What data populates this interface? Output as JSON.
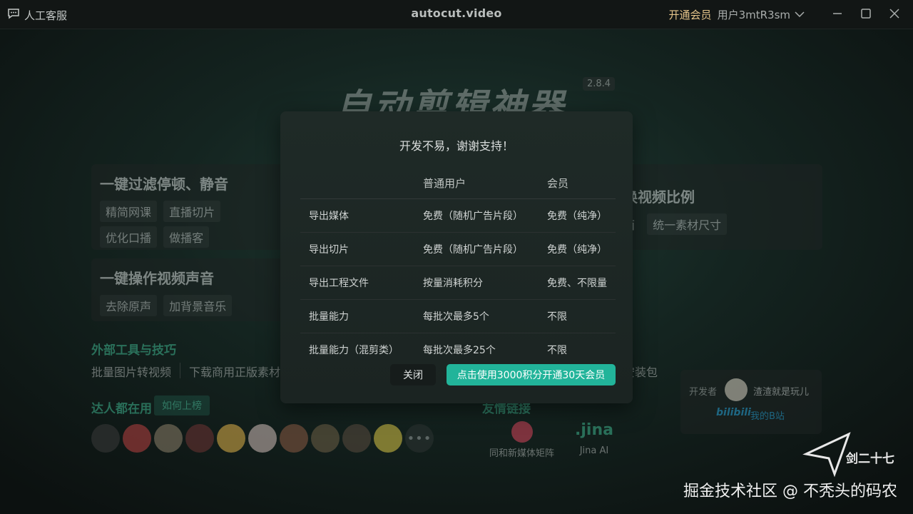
{
  "titlebar": {
    "support_label": "人工客服",
    "app_title": "autocut.video",
    "vip_label": "开通会员",
    "user_label": "用户3mtR3sm"
  },
  "background": {
    "brand": "自动剪辑神器",
    "version": "2.8.4",
    "card1": {
      "title": "一键过滤停顿、静音",
      "chips": [
        "精简网课",
        "直播切片",
        "优化口播",
        "做播客"
      ]
    },
    "card2": {
      "title": "一键操作视频声音",
      "chips": [
        "去除原声",
        "加背景音乐"
      ]
    },
    "card3": {
      "title": "换视频比例",
      "chips": [
        "面",
        "统一素材尺寸"
      ]
    },
    "tools_title": "外部工具与技巧",
    "tools": [
      "批量图片转视频",
      "下载商用正版素材"
    ],
    "tools_tail": "安装包",
    "creators_title": "达人都在用",
    "rank_button": "如何上榜",
    "more_avatars": "•••",
    "avatar_colors": [
      "#3a3a3a",
      "#b94141",
      "#8c7f69",
      "#6e3434",
      "#e0b24a",
      "#d1bdb8",
      "#8a5a43",
      "#6e6046",
      "#5a4c3f",
      "#d9c646"
    ],
    "friends_title": "友情链接",
    "friends": [
      {
        "name": "同和新媒体矩阵",
        "logo_color": "#d6455b"
      },
      {
        "name": "Jina AI",
        "logo_text": ".jina"
      }
    ],
    "developer": {
      "label": "开发者",
      "name": "渣渣就是玩儿",
      "bili_logo": "bilibili",
      "bili_text": "我的B站"
    }
  },
  "modal": {
    "title": "开发不易，谢谢支持！",
    "headers": [
      "",
      "普通用户",
      "会员"
    ],
    "rows": [
      [
        "导出媒体",
        "免费（随机广告片段）",
        "免费（纯净）"
      ],
      [
        "导出切片",
        "免费（随机广告片段）",
        "免费（纯净）"
      ],
      [
        "导出工程文件",
        "按量消耗积分",
        "免费、不限量"
      ],
      [
        "批量能力",
        "每批次最多5个",
        "不限"
      ],
      [
        "批量能力（混剪类）",
        "每批次最多25个",
        "不限"
      ]
    ],
    "close_label": "关闭",
    "buy_label": "点击使用3000积分开通30天会员"
  },
  "watermark": {
    "text": "掘金技术社区 @ 不秃头的码农",
    "mark": "剑二十七"
  },
  "colors": {
    "accent": "#22b49a",
    "green_text": "#3fb48f",
    "vip": "#e4c48a"
  }
}
